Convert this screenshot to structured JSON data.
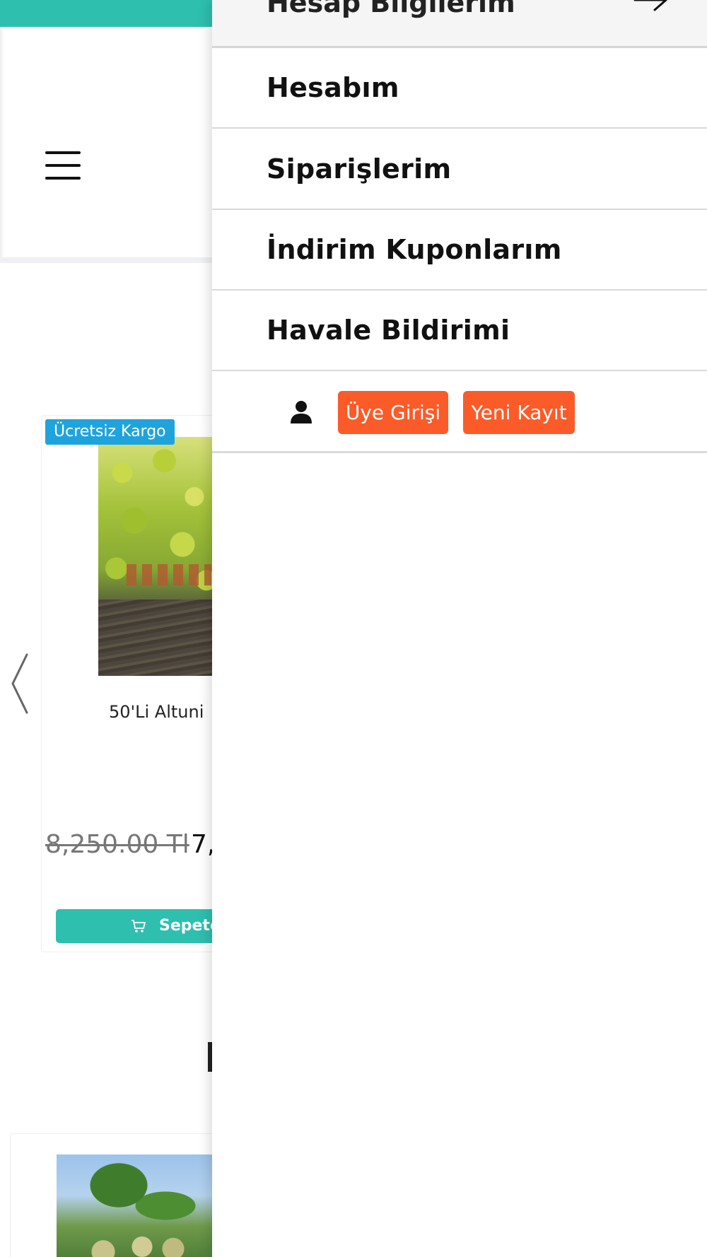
{
  "colors": {
    "accent_teal": "#2ebfaf",
    "badge_blue": "#1fa3dd",
    "button_orange": "#fb5b29",
    "drawer_header_bg": "#f5f5f5"
  },
  "background_page": {
    "menu_icon": "hamburger-icon",
    "prev_icon": "chevron-left-icon",
    "product": {
      "badge": "Ücretsiz Kargo",
      "name": "50'Li Altuni",
      "old_price": "8,250.00 Tl",
      "new_price": "7,",
      "cart_button_label": "Sepete",
      "cart_icon": "cart-icon"
    }
  },
  "drawer": {
    "header_title": "Hesap Bilgilerim",
    "header_icon": "arrow-right-icon",
    "menu_items": [
      {
        "label": "Hesabım"
      },
      {
        "label": "Siparişlerim"
      },
      {
        "label": "İndirim Kuponlarım"
      },
      {
        "label": "Havale Bildirimi"
      }
    ],
    "auth": {
      "user_icon": "user-icon",
      "login_label": "Üye Girişi",
      "register_label": "Yeni Kayıt"
    }
  }
}
